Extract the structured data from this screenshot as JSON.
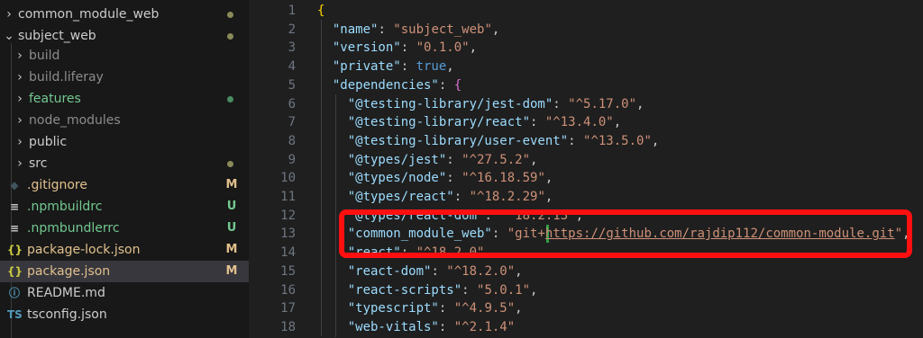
{
  "explorer": {
    "items": [
      {
        "label": "common_module_web",
        "chev": "›",
        "color": "#cccccc",
        "status": "dot",
        "status_color": "#8a8a5a"
      },
      {
        "label": "subject_web",
        "chev": "⌄",
        "color": "#cccccc",
        "status": "dot",
        "status_color": "#8a8a5a"
      },
      {
        "label": "build",
        "chev": "›",
        "color": "#8c8c8c",
        "status": ""
      },
      {
        "label": "build.liferay",
        "chev": "›",
        "color": "#8c8c8c",
        "status": ""
      },
      {
        "label": "features",
        "chev": "›",
        "color": "#73c991",
        "status": "dot",
        "status_color": "#4a8d62"
      },
      {
        "label": "node_modules",
        "chev": "›",
        "color": "#8c8c8c",
        "status": ""
      },
      {
        "label": "public",
        "chev": "›",
        "color": "#cccccc",
        "status": ""
      },
      {
        "label": "src",
        "chev": "›",
        "color": "#cccccc",
        "status": "dot",
        "status_color": "#8a8a5a"
      },
      {
        "label": ".gitignore",
        "icon": "◆",
        "icon_color": "#41535b",
        "color": "#e2c08d",
        "status": "M",
        "status_color": "#e2c08d"
      },
      {
        "label": ".npmbuildrc",
        "icon": "≡",
        "icon_color": "#cccccc",
        "color": "#73c991",
        "status": "U",
        "status_color": "#73c991"
      },
      {
        "label": ".npmbundlerrc",
        "icon": "≡",
        "icon_color": "#cccccc",
        "color": "#73c991",
        "status": "U",
        "status_color": "#73c991"
      },
      {
        "label": "package-lock.json",
        "icon": "{}",
        "icon_color": "#cbcb41",
        "color": "#e2c08d",
        "status": "M",
        "status_color": "#e2c08d"
      },
      {
        "label": "package.json",
        "icon": "{}",
        "icon_color": "#cbcb41",
        "color": "#e2c08d",
        "status": "M",
        "status_color": "#e2c08d",
        "selected": true
      },
      {
        "label": "README.md",
        "icon": "ⓘ",
        "icon_color": "#519aba",
        "color": "#cccccc",
        "status": ""
      },
      {
        "label": "tsconfig.json",
        "icon": "TS",
        "icon_color": "#519aba",
        "color": "#cccccc",
        "status": ""
      }
    ]
  },
  "editor": {
    "lines": [
      {
        "n": "1",
        "tokens": [
          {
            "t": "{",
            "c": "b1"
          }
        ]
      },
      {
        "n": "2",
        "tokens": [
          {
            "t": "  "
          },
          {
            "t": "\"name\"",
            "c": "k"
          },
          {
            "t": ": ",
            "c": "p"
          },
          {
            "t": "\"subject_web\"",
            "c": "s"
          },
          {
            "t": ",",
            "c": "p"
          }
        ]
      },
      {
        "n": "3",
        "tokens": [
          {
            "t": "  "
          },
          {
            "t": "\"version\"",
            "c": "k"
          },
          {
            "t": ": ",
            "c": "p"
          },
          {
            "t": "\"0.1.0\"",
            "c": "s"
          },
          {
            "t": ",",
            "c": "p"
          }
        ]
      },
      {
        "n": "4",
        "tokens": [
          {
            "t": "  "
          },
          {
            "t": "\"private\"",
            "c": "k"
          },
          {
            "t": ": ",
            "c": "p"
          },
          {
            "t": "true",
            "c": "kw"
          },
          {
            "t": ",",
            "c": "p"
          }
        ]
      },
      {
        "n": "5",
        "tokens": [
          {
            "t": "  "
          },
          {
            "t": "\"dependencies\"",
            "c": "k"
          },
          {
            "t": ": ",
            "c": "p"
          },
          {
            "t": "{",
            "c": "b2"
          }
        ]
      },
      {
        "n": "6",
        "tokens": [
          {
            "t": "    "
          },
          {
            "t": "\"@testing-library/jest-dom\"",
            "c": "k"
          },
          {
            "t": ": ",
            "c": "p"
          },
          {
            "t": "\"^5.17.0\"",
            "c": "s"
          },
          {
            "t": ",",
            "c": "p"
          }
        ]
      },
      {
        "n": "7",
        "tokens": [
          {
            "t": "    "
          },
          {
            "t": "\"@testing-library/react\"",
            "c": "k"
          },
          {
            "t": ": ",
            "c": "p"
          },
          {
            "t": "\"^13.4.0\"",
            "c": "s"
          },
          {
            "t": ",",
            "c": "p"
          }
        ]
      },
      {
        "n": "8",
        "tokens": [
          {
            "t": "    "
          },
          {
            "t": "\"@testing-library/user-event\"",
            "c": "k"
          },
          {
            "t": ": ",
            "c": "p"
          },
          {
            "t": "\"^13.5.0\"",
            "c": "s"
          },
          {
            "t": ",",
            "c": "p"
          }
        ]
      },
      {
        "n": "9",
        "tokens": [
          {
            "t": "    "
          },
          {
            "t": "\"@types/jest\"",
            "c": "k"
          },
          {
            "t": ": ",
            "c": "p"
          },
          {
            "t": "\"^27.5.2\"",
            "c": "s"
          },
          {
            "t": ",",
            "c": "p"
          }
        ]
      },
      {
        "n": "10",
        "tokens": [
          {
            "t": "    "
          },
          {
            "t": "\"@types/node\"",
            "c": "k"
          },
          {
            "t": ": ",
            "c": "p"
          },
          {
            "t": "\"^16.18.59\"",
            "c": "s"
          },
          {
            "t": ",",
            "c": "p"
          }
        ]
      },
      {
        "n": "11",
        "tokens": [
          {
            "t": "    "
          },
          {
            "t": "\"@types/react\"",
            "c": "k"
          },
          {
            "t": ": ",
            "c": "p"
          },
          {
            "t": "\"^18.2.29\"",
            "c": "s"
          },
          {
            "t": ",",
            "c": "p"
          }
        ]
      },
      {
        "n": "12",
        "tokens": [
          {
            "t": "    "
          },
          {
            "t": "\"@types/react-dom\"",
            "c": "k"
          },
          {
            "t": ": ",
            "c": "p"
          },
          {
            "t": "\"^18.2.13\"",
            "c": "s"
          },
          {
            "t": ",",
            "c": "p"
          }
        ]
      },
      {
        "n": "13",
        "tokens": [
          {
            "t": "    "
          },
          {
            "t": "\"common_module_web\"",
            "c": "k"
          },
          {
            "t": ": ",
            "c": "p"
          },
          {
            "t": "\"git+",
            "c": "s"
          },
          {
            "t": "https://github.com/rajdip112/common-module.git",
            "c": "s",
            "link": true
          },
          {
            "t": "\"",
            "c": "s"
          },
          {
            "t": ",",
            "c": "p"
          }
        ]
      },
      {
        "n": "14",
        "tokens": [
          {
            "t": "    "
          },
          {
            "t": "\"react\"",
            "c": "k"
          },
          {
            "t": ": ",
            "c": "p"
          },
          {
            "t": "\"^18.2.0\"",
            "c": "s"
          },
          {
            "t": ",",
            "c": "p"
          }
        ]
      },
      {
        "n": "15",
        "tokens": [
          {
            "t": "    "
          },
          {
            "t": "\"react-dom\"",
            "c": "k"
          },
          {
            "t": ": ",
            "c": "p"
          },
          {
            "t": "\"^18.2.0\"",
            "c": "s"
          },
          {
            "t": ",",
            "c": "p"
          }
        ]
      },
      {
        "n": "16",
        "tokens": [
          {
            "t": "    "
          },
          {
            "t": "\"react-scripts\"",
            "c": "k"
          },
          {
            "t": ": ",
            "c": "p"
          },
          {
            "t": "\"5.0.1\"",
            "c": "s"
          },
          {
            "t": ",",
            "c": "p"
          }
        ]
      },
      {
        "n": "17",
        "tokens": [
          {
            "t": "    "
          },
          {
            "t": "\"typescript\"",
            "c": "k"
          },
          {
            "t": ": ",
            "c": "p"
          },
          {
            "t": "\"^4.9.5\"",
            "c": "s"
          },
          {
            "t": ",",
            "c": "p"
          }
        ]
      },
      {
        "n": "18",
        "tokens": [
          {
            "t": "    "
          },
          {
            "t": "\"web-vitals\"",
            "c": "k"
          },
          {
            "t": ": ",
            "c": "p"
          },
          {
            "t": "\"^2.1.4\"",
            "c": "s"
          }
        ]
      }
    ]
  },
  "colors": {
    "highlight": "#ff1010",
    "git_added": "#2ea043"
  }
}
